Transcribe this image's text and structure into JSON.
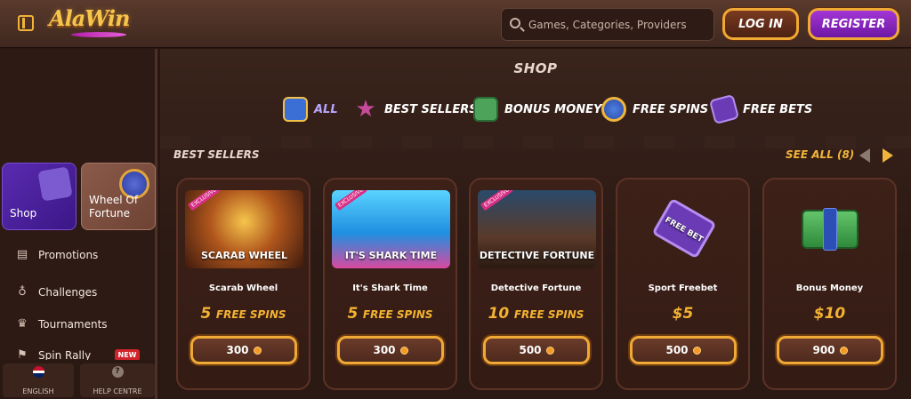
{
  "header": {
    "logo": "AlaWin",
    "search_placeholder": "Games, Categories, Providers",
    "login_label": "LOG IN",
    "register_label": "REGISTER"
  },
  "sidebar": {
    "cards": [
      {
        "label": "Shop"
      },
      {
        "label": "Wheel Of Fortune"
      }
    ],
    "items": [
      {
        "label": "Promotions",
        "icon": "promotions-icon"
      },
      {
        "label": "Challenges",
        "icon": "challenges-icon"
      },
      {
        "label": "Tournaments",
        "icon": "trophy-icon"
      },
      {
        "label": "Spin Rally",
        "icon": "spin-rally-icon"
      }
    ],
    "new_badge": "NEW",
    "bottom": {
      "language_label": "ENGLISH",
      "help_label": "HELP CENTRE"
    }
  },
  "main": {
    "title": "SHOP",
    "categories": [
      {
        "label": "ALL",
        "icon": "shop-bag-icon"
      },
      {
        "label": "BEST SELLERS",
        "icon": "star-icon"
      },
      {
        "label": "BONUS MONEY",
        "icon": "money-icon"
      },
      {
        "label": "FREE SPINS",
        "icon": "free-spins-icon"
      },
      {
        "label": "FREE BETS",
        "icon": "ticket-icon"
      }
    ],
    "section": {
      "title": "BEST SELLERS",
      "see_all": "SEE ALL (8)"
    },
    "products": [
      {
        "name": "Scarab Wheel",
        "prize": "5",
        "unit": "FREE SPINS",
        "price": "300",
        "image_text": "SCARAB WHEEL",
        "exclusive": "EXCLUSIVE"
      },
      {
        "name": "It's Shark Time",
        "prize": "5",
        "unit": "FREE SPINS",
        "price": "300",
        "image_text": "IT'S SHARK TIME",
        "exclusive": "EXCLUSIVE"
      },
      {
        "name": "Detective Fortune",
        "prize": "10",
        "unit": "FREE SPINS",
        "price": "500",
        "image_text": "DETECTIVE FORTUNE",
        "exclusive": "EXCLUSIVE"
      },
      {
        "name": "Sport Freebet",
        "prize": "$5",
        "unit": "",
        "price": "500",
        "image_text": "FREE BET",
        "exclusive": ""
      },
      {
        "name": "Bonus Money",
        "prize": "$10",
        "unit": "",
        "price": "900",
        "image_text": "",
        "exclusive": ""
      }
    ]
  }
}
